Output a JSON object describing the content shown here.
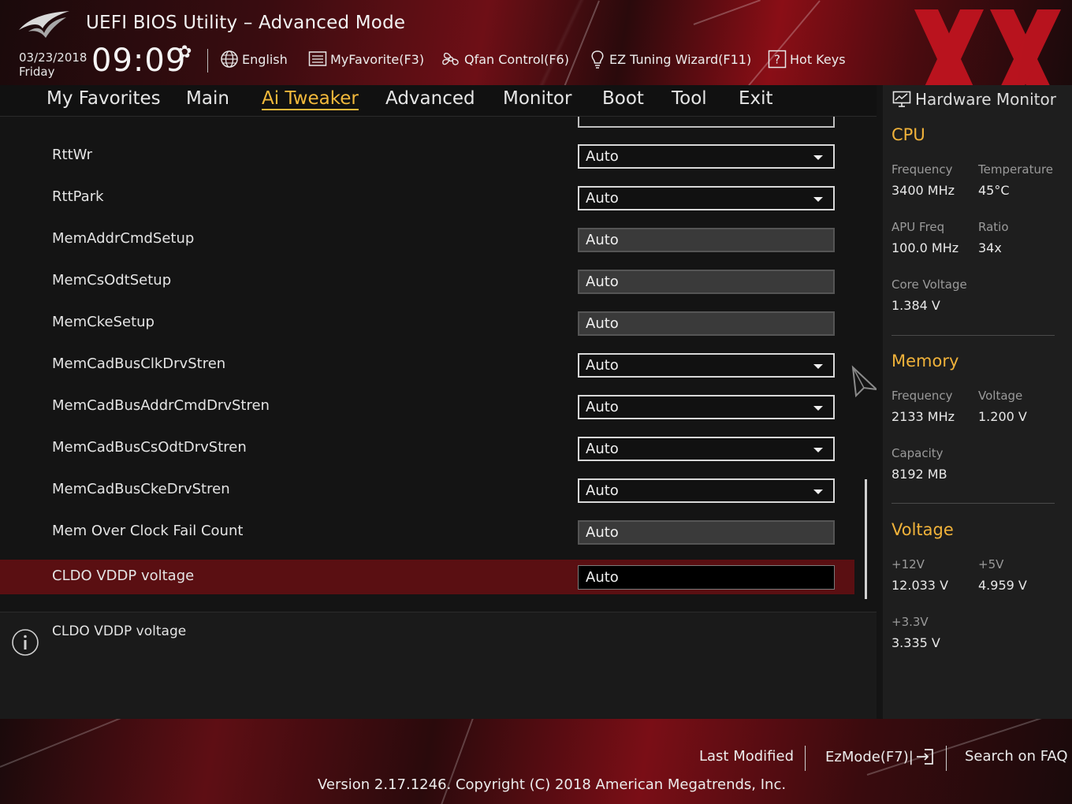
{
  "header": {
    "app_title": "UEFI BIOS Utility – Advanced Mode",
    "date": "03/23/2018",
    "day": "Friday",
    "time": "09:09",
    "toolbar": [
      {
        "name": "language",
        "label": "English",
        "icon": "globe-icon"
      },
      {
        "name": "myfavorite",
        "label": "MyFavorite(F3)",
        "icon": "list-icon"
      },
      {
        "name": "qfan",
        "label": "Qfan Control(F6)",
        "icon": "fan-icon"
      },
      {
        "name": "ez-tuning",
        "label": "EZ Tuning Wizard(F11)",
        "icon": "bulb-icon"
      },
      {
        "name": "hotkeys",
        "label": "Hot Keys",
        "icon": "question-icon"
      }
    ]
  },
  "nav": {
    "tabs": [
      "My Favorites",
      "Main",
      "Ai Tweaker",
      "Advanced",
      "Monitor",
      "Boot",
      "Tool",
      "Exit"
    ],
    "active": "Ai Tweaker"
  },
  "settings": [
    {
      "label": "RttWr",
      "value": "Auto",
      "kind": "dropdown"
    },
    {
      "label": "RttPark",
      "value": "Auto",
      "kind": "dropdown"
    },
    {
      "label": "MemAddrCmdSetup",
      "value": "Auto",
      "kind": "readonly"
    },
    {
      "label": "MemCsOdtSetup",
      "value": "Auto",
      "kind": "readonly"
    },
    {
      "label": "MemCkeSetup",
      "value": "Auto",
      "kind": "readonly"
    },
    {
      "label": "MemCadBusClkDrvStren",
      "value": "Auto",
      "kind": "dropdown"
    },
    {
      "label": "MemCadBusAddrCmdDrvStren",
      "value": "Auto",
      "kind": "dropdown"
    },
    {
      "label": "MemCadBusCsOdtDrvStren",
      "value": "Auto",
      "kind": "dropdown"
    },
    {
      "label": "MemCadBusCkeDrvStren",
      "value": "Auto",
      "kind": "dropdown"
    },
    {
      "label": "Mem Over Clock Fail Count",
      "value": "Auto",
      "kind": "readonly"
    },
    {
      "label": "CLDO VDDP voltage",
      "value": "Auto",
      "kind": "input",
      "selected": true
    }
  ],
  "help": {
    "text": "CLDO VDDP voltage"
  },
  "hwmon": {
    "title": "Hardware Monitor",
    "cpu": {
      "section": "CPU",
      "frequency_label": "Frequency",
      "frequency": "3400 MHz",
      "temperature_label": "Temperature",
      "temperature": "45°C",
      "apu_label": "APU Freq",
      "apu": "100.0 MHz",
      "ratio_label": "Ratio",
      "ratio": "34x",
      "core_voltage_label": "Core Voltage",
      "core_voltage": "1.384 V"
    },
    "memory": {
      "section": "Memory",
      "frequency_label": "Frequency",
      "frequency": "2133 MHz",
      "voltage_label": "Voltage",
      "voltage": "1.200 V",
      "capacity_label": "Capacity",
      "capacity": "8192 MB"
    },
    "voltage": {
      "section": "Voltage",
      "v12_label": "+12V",
      "v12": "12.033 V",
      "v5_label": "+5V",
      "v5": "4.959 V",
      "v33_label": "+3.3V",
      "v33": "3.335 V"
    }
  },
  "footer": {
    "last_modified": "Last Modified",
    "ezmode": "EzMode(F7)|",
    "search_faq": "Search on FAQ",
    "version": "Version 2.17.1246. Copyright (C) 2018 American Megatrends, Inc."
  },
  "colors": {
    "accent": "#f2b93b",
    "selected_row": "#5a0f12",
    "brand_red": "#c41420"
  }
}
